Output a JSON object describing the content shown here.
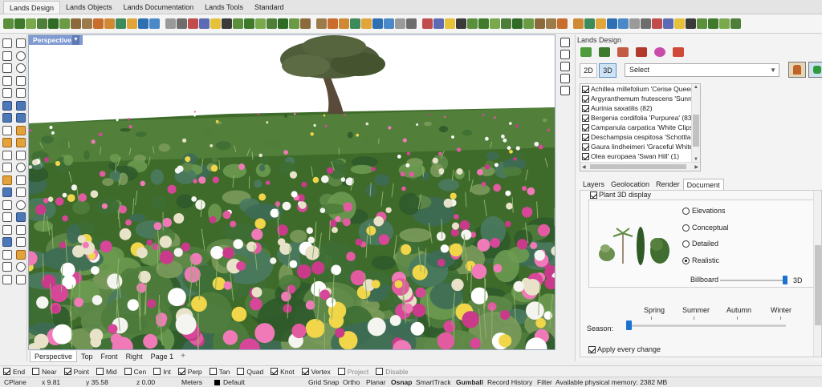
{
  "tabs": [
    "Lands Design",
    "Lands Objects",
    "Lands Documentation",
    "Lands Tools",
    "Standard"
  ],
  "viewport": {
    "label": "Perspective",
    "tabs": [
      "Perspective",
      "Top",
      "Front",
      "Right",
      "Page 1"
    ],
    "add_tab": "+"
  },
  "panel": {
    "title": "Lands Design",
    "btn_2d": "2D",
    "btn_3d": "3D",
    "select_value": "Select",
    "plants": [
      "Achillea millefolium 'Cerise Queen'",
      "Argyranthemum frutescens 'Sunny",
      "Aurinia saxatilis  (82)",
      "Bergenia cordifolia 'Purpurea'  (83",
      "Campanula carpatica 'White Clips'",
      "Deschampsia cespitosa 'Schottlan",
      "Gaura lindheimeri 'Graceful White",
      "Olea europaea 'Swan Hill'  (1)"
    ],
    "prop_tabs": [
      "Layers",
      "Geolocation",
      "Render",
      "Document"
    ],
    "plant3d_label": "Plant 3D display",
    "display_options": [
      "Elevations",
      "Conceptual",
      "Detailed",
      "Realistic"
    ],
    "display_selected": "Realistic",
    "billboard_label": "Billboard",
    "billboard_end": "3D",
    "seasons": [
      "Spring",
      "Summer",
      "Autumn",
      "Winter"
    ],
    "season_label": "Season:",
    "apply_label": "Apply every change"
  },
  "osnap": [
    {
      "label": "End",
      "checked": true
    },
    {
      "label": "Near",
      "checked": false
    },
    {
      "label": "Point",
      "checked": true
    },
    {
      "label": "Mid",
      "checked": false
    },
    {
      "label": "Cen",
      "checked": false
    },
    {
      "label": "Int",
      "checked": false
    },
    {
      "label": "Perp",
      "checked": true
    },
    {
      "label": "Tan",
      "checked": false
    },
    {
      "label": "Quad",
      "checked": false
    },
    {
      "label": "Knot",
      "checked": true
    },
    {
      "label": "Vertex",
      "checked": true
    },
    {
      "label": "Project",
      "checked": false
    },
    {
      "label": "Disable",
      "checked": false
    }
  ],
  "status": {
    "cplane": "CPlane",
    "x": "x 9.81",
    "y": "y 35.58",
    "z": "z 0.00",
    "units": "Meters",
    "layer": "Default",
    "grid_snap": "Grid Snap",
    "ortho": "Ortho",
    "planar": "Planar",
    "osnap": "Osnap",
    "smarttrack": "SmartTrack",
    "gumball": "Gumball",
    "record_history": "Record History",
    "filter": "Filter",
    "memory": "Available physical memory: 2382 MB"
  },
  "colors": {
    "sky": "#ffffff",
    "grass": "#3e6b2a",
    "accent": "#1a73d2",
    "viewport_label": "#7f9bd1"
  }
}
